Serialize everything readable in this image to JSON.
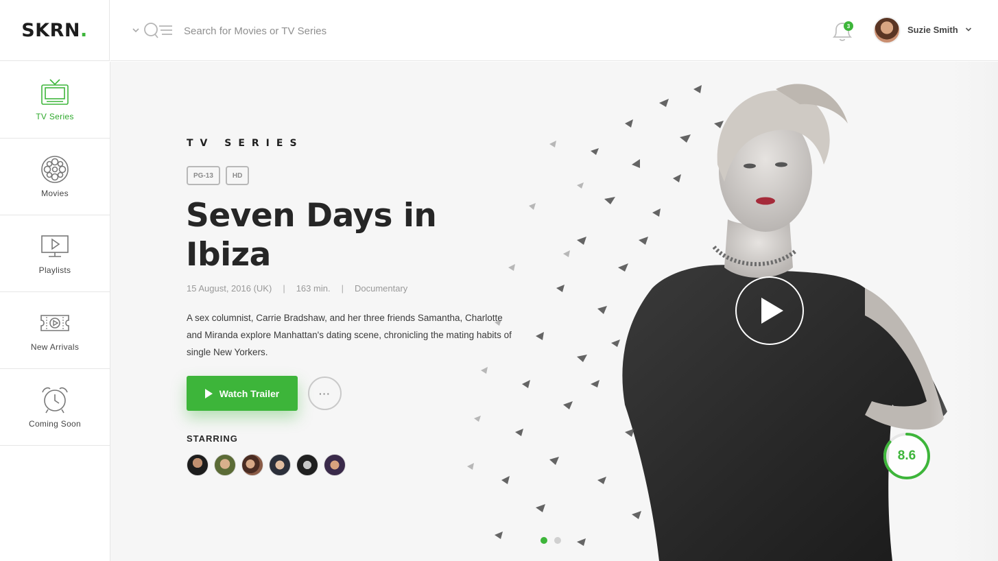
{
  "brand": {
    "name": "SKRN",
    "dot": ".",
    "accent": "#3db53a"
  },
  "search": {
    "placeholder": "Search for Movies or TV Series"
  },
  "notifications": {
    "count": "3"
  },
  "user": {
    "name": "Suzie Smith"
  },
  "sidebar": {
    "items": [
      {
        "label": "TV Series",
        "icon": "tv-icon",
        "active": true
      },
      {
        "label": "Movies",
        "icon": "film-reel-icon",
        "active": false
      },
      {
        "label": "Playlists",
        "icon": "monitor-play-icon",
        "active": false
      },
      {
        "label": "New Arrivals",
        "icon": "ticket-icon",
        "active": false
      },
      {
        "label": "Coming Soon",
        "icon": "alarm-clock-icon",
        "active": false
      }
    ]
  },
  "hero": {
    "eyebrow": "TV SERIES",
    "badges": [
      "PG-13",
      "HD"
    ],
    "title": "Seven Days in Ibiza",
    "meta": {
      "date": "15 August, 2016 (UK)",
      "duration": "163 min.",
      "genre": "Documentary",
      "separator": "|"
    },
    "description": "A sex columnist, Carrie Bradshaw, and her three friends Samantha, Charlotte and Miranda explore Manhattan's dating scene, chronicling the mating habits of single New Yorkers.",
    "watch_label": "Watch Trailer",
    "more_label": "···",
    "starring_label": "STARRING",
    "cast_count": 6,
    "rating": "8.6",
    "rating_fraction": 0.86,
    "slides": 2,
    "active_slide": 0
  }
}
